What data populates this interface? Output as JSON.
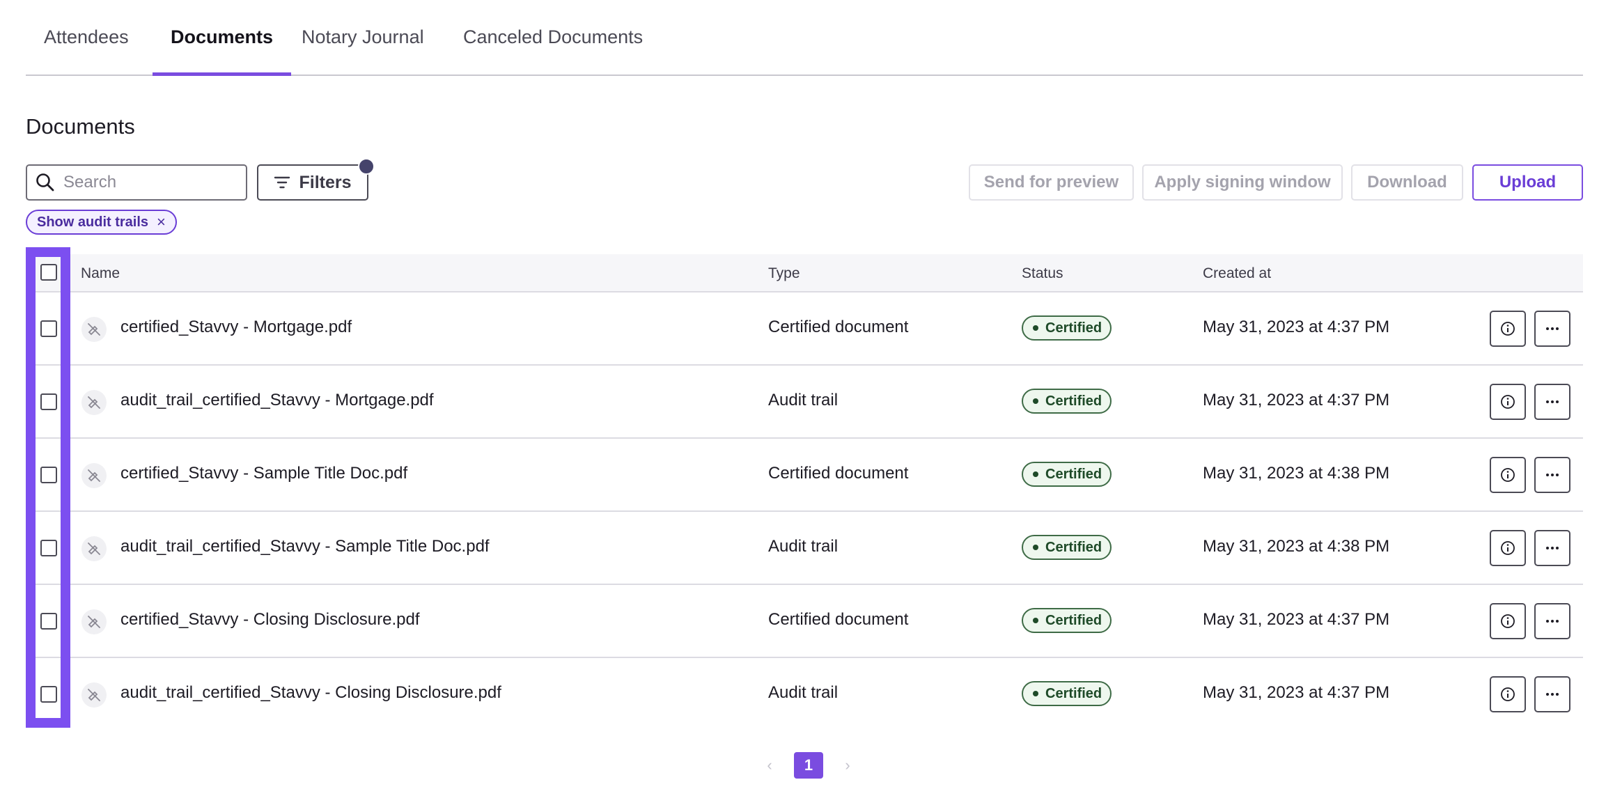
{
  "tabs": [
    {
      "label": "Attendees",
      "active": false
    },
    {
      "label": "Documents",
      "active": true
    },
    {
      "label": "Notary Journal",
      "active": false
    },
    {
      "label": "Canceled Documents",
      "active": false
    }
  ],
  "section_title": "Documents",
  "search": {
    "placeholder": "Search",
    "value": ""
  },
  "filters_label": "Filters",
  "toolbar": {
    "send_preview": "Send for preview",
    "apply_window": "Apply signing window",
    "download": "Download",
    "upload": "Upload"
  },
  "chip": {
    "label": "Show audit trails",
    "close": "×"
  },
  "table": {
    "headers": {
      "name": "Name",
      "type": "Type",
      "status": "Status",
      "created": "Created at"
    },
    "rows": [
      {
        "name": "certified_Stavvy - Mortgage.pdf",
        "type": "Certified document",
        "status": "Certified",
        "created": "May 31, 2023 at 4:37 PM"
      },
      {
        "name": "audit_trail_certified_Stavvy - Mortgage.pdf",
        "type": "Audit trail",
        "status": "Certified",
        "created": "May 31, 2023 at 4:37 PM"
      },
      {
        "name": "certified_Stavvy - Sample Title Doc.pdf",
        "type": "Certified document",
        "status": "Certified",
        "created": "May 31, 2023 at 4:38 PM"
      },
      {
        "name": "audit_trail_certified_Stavvy - Sample Title Doc.pdf",
        "type": "Audit trail",
        "status": "Certified",
        "created": "May 31, 2023 at 4:38 PM"
      },
      {
        "name": "certified_Stavvy - Closing Disclosure.pdf",
        "type": "Certified document",
        "status": "Certified",
        "created": "May 31, 2023 at 4:37 PM"
      },
      {
        "name": "audit_trail_certified_Stavvy - Closing Disclosure.pdf",
        "type": "Audit trail",
        "status": "Certified",
        "created": "May 31, 2023 at 4:37 PM"
      }
    ]
  },
  "pagination": {
    "prev": "‹",
    "current": "1",
    "next": "›"
  },
  "colors": {
    "accent": "#7a4ce0",
    "certified": "#1e4a28",
    "highlight": "#7c4ff0"
  }
}
